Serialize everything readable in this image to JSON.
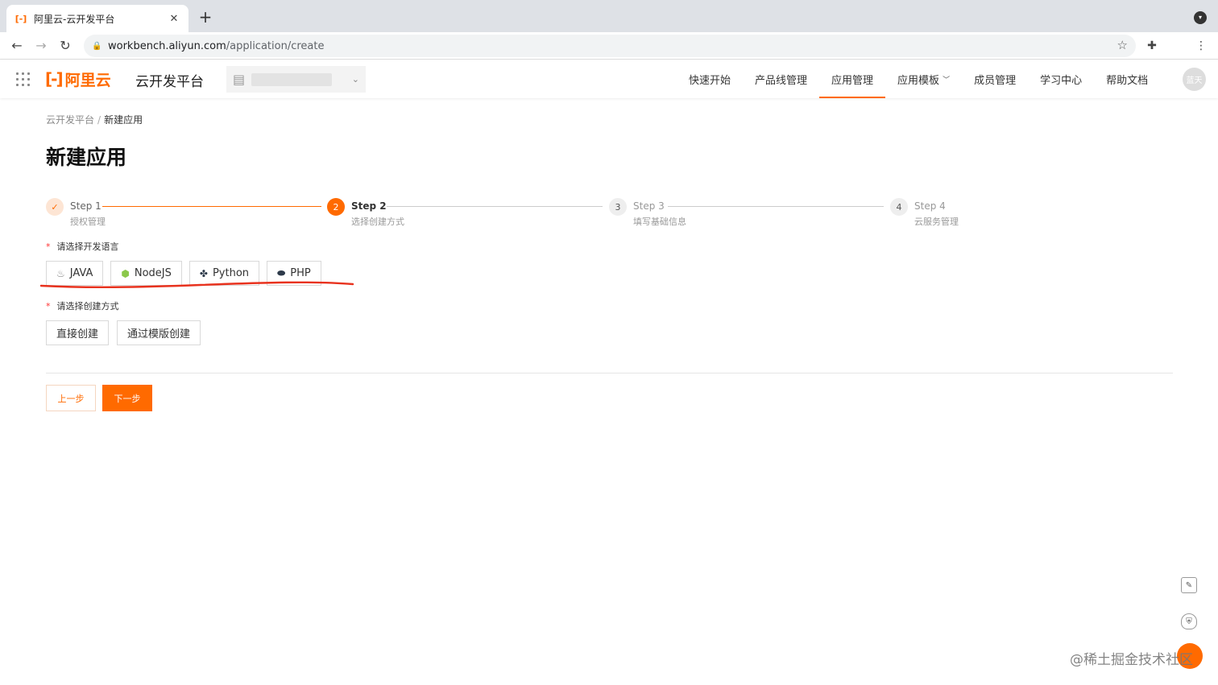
{
  "browser": {
    "tab_title": "阿里云-云开发平台",
    "tab_favicon": "[-]",
    "close_glyph": "✕",
    "new_tab_glyph": "+",
    "url_host": "workbench.aliyun.com",
    "url_path": "/application/create"
  },
  "header": {
    "logo_text": "阿里云",
    "logo_bracket": "[-]",
    "platform_name": "云开发平台",
    "nav": [
      {
        "label": "快速开始"
      },
      {
        "label": "产品线管理"
      },
      {
        "label": "应用管理"
      },
      {
        "label": "应用模板"
      },
      {
        "label": "成员管理"
      },
      {
        "label": "学习中心"
      },
      {
        "label": "帮助文档"
      }
    ],
    "avatar_text": "蓝天"
  },
  "breadcrumb": {
    "root": "云开发平台",
    "separator": "/",
    "current": "新建应用"
  },
  "page_title": "新建应用",
  "steps": [
    {
      "title": "Step 1",
      "desc": "授权管理",
      "marker": "✓",
      "status": "done"
    },
    {
      "title": "Step 2",
      "desc": "选择创建方式",
      "marker": "2",
      "status": "current"
    },
    {
      "title": "Step 3",
      "desc": "填写基础信息",
      "marker": "3",
      "status": "wait"
    },
    {
      "title": "Step 4",
      "desc": "云服务管理",
      "marker": "4",
      "status": "wait"
    }
  ],
  "form": {
    "required_mark": "*",
    "language_label": "请选择开发语言",
    "languages": [
      {
        "label": "JAVA"
      },
      {
        "label": "NodeJS"
      },
      {
        "label": "Python"
      },
      {
        "label": "PHP"
      }
    ],
    "create_label": "请选择创建方式",
    "create_options": [
      {
        "label": "直接创建"
      },
      {
        "label": "通过模版创建"
      }
    ]
  },
  "actions": {
    "prev": "上一步",
    "next": "下一步"
  },
  "watermark": "@稀土掘金技术社区",
  "colors": {
    "accent": "#ff6a00",
    "annotation": "#e8321e"
  }
}
